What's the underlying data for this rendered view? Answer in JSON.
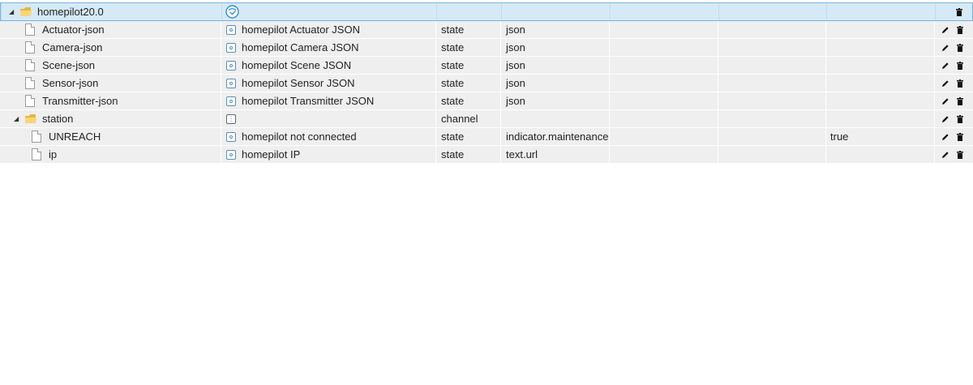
{
  "tree": {
    "root": {
      "name": "homepilot20.0"
    },
    "rows": [
      {
        "id": "actuator",
        "name": "Actuator-json",
        "title": "homepilot Actuator JSON",
        "type": "state",
        "role": "json",
        "value": ""
      },
      {
        "id": "camera",
        "name": "Camera-json",
        "title": "homepilot Camera JSON",
        "type": "state",
        "role": "json",
        "value": ""
      },
      {
        "id": "scene",
        "name": "Scene-json",
        "title": "homepilot Scene JSON",
        "type": "state",
        "role": "json",
        "value": ""
      },
      {
        "id": "sensor",
        "name": "Sensor-json",
        "title": "homepilot Sensor JSON",
        "type": "state",
        "role": "json",
        "value": ""
      },
      {
        "id": "transmitter",
        "name": "Transmitter-json",
        "title": "homepilot Transmitter JSON",
        "type": "state",
        "role": "json",
        "value": ""
      }
    ],
    "channel": {
      "name": "station",
      "type": "channel"
    },
    "channel_rows": [
      {
        "id": "unreach",
        "name": "UNREACH",
        "title": "homepilot not connected",
        "type": "state",
        "role": "indicator.maintenance.unreach",
        "value": "true"
      },
      {
        "id": "ip",
        "name": "ip",
        "title": "homepilot IP",
        "type": "state",
        "role": "text.url",
        "value": ""
      }
    ]
  },
  "icons": {
    "expand": "triangle-down-icon",
    "folder": "folder-icon",
    "file": "file-icon",
    "state": "state-icon",
    "channel": "channel-icon",
    "adapter": "homepilot-adapter-icon",
    "edit": "pencil-icon",
    "delete": "trash-icon"
  },
  "colors": {
    "row_bg": "#efefef",
    "root_bg": "#d5eaf6",
    "root_border": "#7ab4de",
    "folder": "#f2c14e",
    "adapter": "#2f8fd0"
  }
}
